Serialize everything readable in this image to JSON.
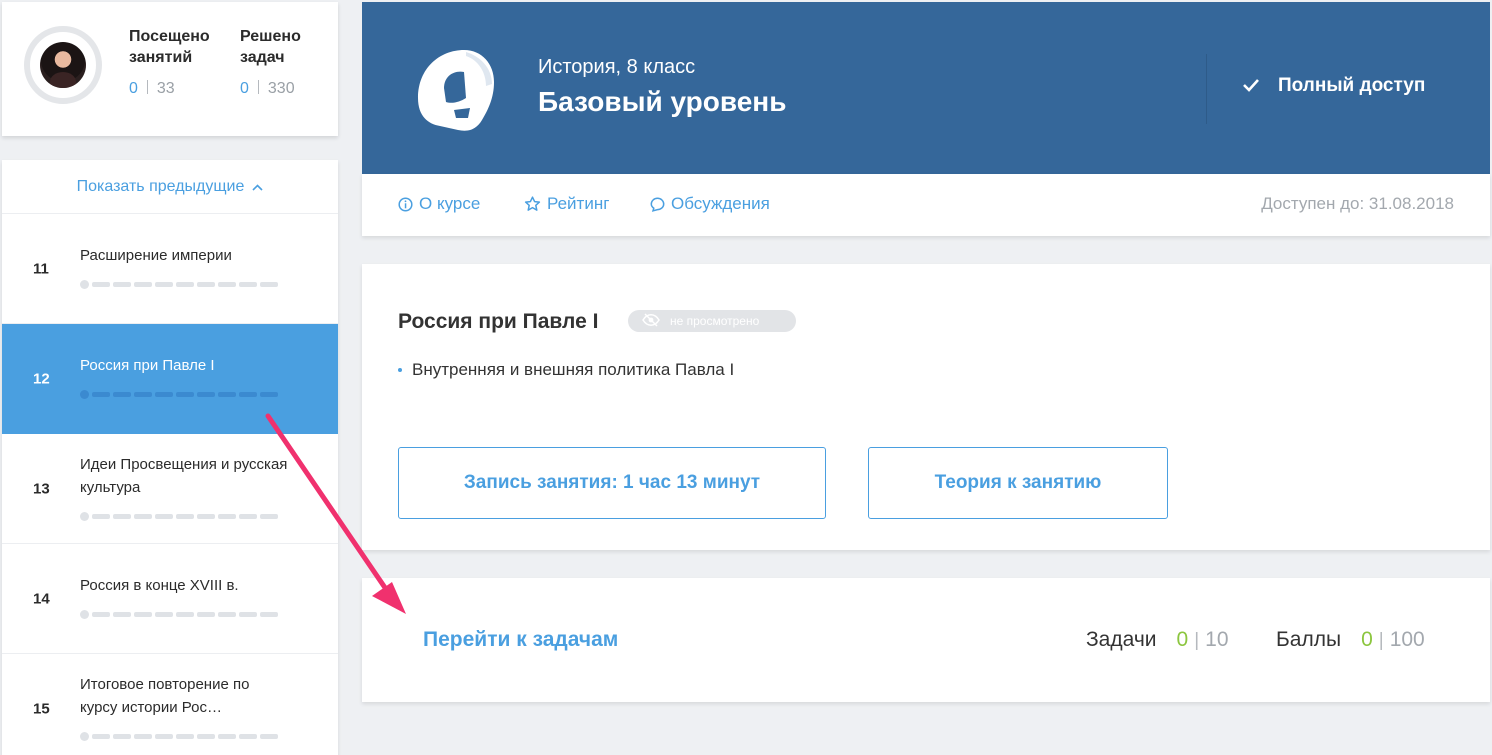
{
  "profile": {
    "visited_label_1": "Посещено",
    "visited_label_2": "занятий",
    "visited_current": "0",
    "visited_total": "33",
    "solved_label_1": "Решено",
    "solved_label_2": "задач",
    "solved_current": "0",
    "solved_total": "330"
  },
  "sidebar": {
    "show_previous": "Показать предыдущие",
    "lessons": [
      {
        "num": "11",
        "title": "Расширение империи"
      },
      {
        "num": "12",
        "title": "Россия при Павле I"
      },
      {
        "num": "13",
        "title": "Идеи Просвещения и русская культура"
      },
      {
        "num": "14",
        "title": "Россия в конце XVIII в."
      },
      {
        "num": "15",
        "title": "Итоговое повторение по курсу истории Рос…"
      }
    ]
  },
  "header": {
    "subject": "История, 8 класс",
    "level": "Базовый уровень",
    "access": "Полный доступ"
  },
  "nav": {
    "about": "О курсе",
    "rating": "Рейтинг",
    "discussions": "Обсуждения",
    "available_until": "Доступен до: 31.08.2018"
  },
  "lesson": {
    "title": "Россия при Павле I",
    "status": "не просмотрено",
    "topics": [
      "Внутренняя и внешняя политика Павла I"
    ],
    "record_button": "Запись занятия: 1 час 13 минут",
    "theory_button": "Теория к занятию"
  },
  "tasks": {
    "goto_label": "Перейти к задачам",
    "tasks_label": "Задачи",
    "tasks_current": "0",
    "tasks_total": "10",
    "points_label": "Баллы",
    "points_current": "0",
    "points_total": "100"
  },
  "colors": {
    "accent": "#4a9fe0",
    "header_bg": "#35679a",
    "success": "#8cc63f",
    "annotation_arrow": "#f0316e"
  }
}
